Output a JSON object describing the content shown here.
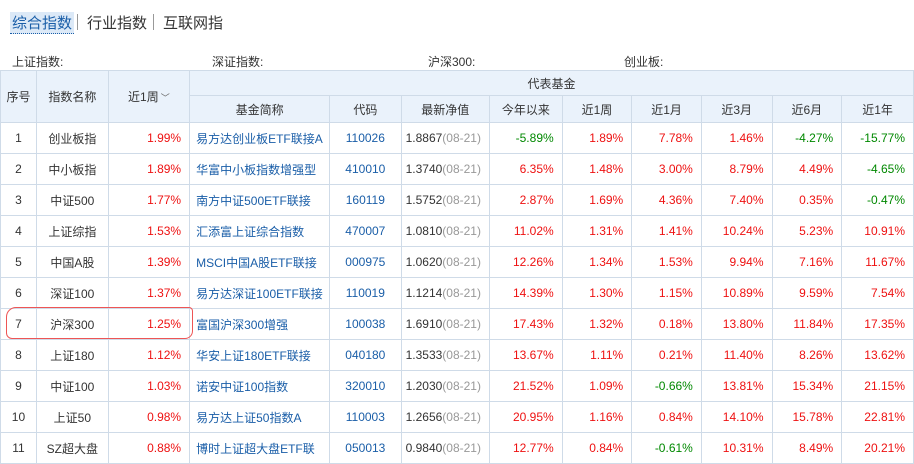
{
  "tabs": [
    {
      "label": "综合指数",
      "active": true
    },
    {
      "label": "行业指数",
      "active": false
    },
    {
      "label": "互联网指",
      "active": false
    }
  ],
  "quotes": [
    {
      "label": "上证指数:"
    },
    {
      "label": "深证指数:"
    },
    {
      "label": "沪深300:"
    },
    {
      "label": "创业板:"
    }
  ],
  "headers": {
    "index": "序号",
    "name": "指数名称",
    "week": "近1周",
    "group": "代表基金",
    "fund": "基金简称",
    "code": "代码",
    "nav": "最新净值",
    "ytd": "今年以来",
    "f1w": "近1周",
    "f1m": "近1月",
    "f3m": "近3月",
    "f6m": "近6月",
    "f1y": "近1年"
  },
  "rows": [
    {
      "no": "1",
      "name": "创业板指",
      "week": "1.99%",
      "fund": "易方达创业板ETF联接A",
      "code": "110026",
      "nav": "1.8867",
      "date": "(08-21)",
      "ytd": "-5.89%",
      "w1": "1.89%",
      "m1": "7.78%",
      "m3": "1.46%",
      "m6": "-4.27%",
      "y1": "-15.77%"
    },
    {
      "no": "2",
      "name": "中小板指",
      "week": "1.89%",
      "fund": "华富中小板指数增强型",
      "code": "410010",
      "nav": "1.3740",
      "date": "(08-21)",
      "ytd": "6.35%",
      "w1": "1.48%",
      "m1": "3.00%",
      "m3": "8.79%",
      "m6": "4.49%",
      "y1": "-4.65%"
    },
    {
      "no": "3",
      "name": "中证500",
      "week": "1.77%",
      "fund": "南方中证500ETF联接",
      "code": "160119",
      "nav": "1.5752",
      "date": "(08-21)",
      "ytd": "2.87%",
      "w1": "1.69%",
      "m1": "4.36%",
      "m3": "7.40%",
      "m6": "0.35%",
      "y1": "-0.47%"
    },
    {
      "no": "4",
      "name": "上证综指",
      "week": "1.53%",
      "fund": "汇添富上证综合指数",
      "code": "470007",
      "nav": "1.0810",
      "date": "(08-21)",
      "ytd": "11.02%",
      "w1": "1.31%",
      "m1": "1.41%",
      "m3": "10.24%",
      "m6": "5.23%",
      "y1": "10.91%"
    },
    {
      "no": "5",
      "name": "中国A股",
      "week": "1.39%",
      "fund": "MSCI中国A股ETF联接",
      "code": "000975",
      "nav": "1.0620",
      "date": "(08-21)",
      "ytd": "12.26%",
      "w1": "1.34%",
      "m1": "1.53%",
      "m3": "9.94%",
      "m6": "7.16%",
      "y1": "11.67%"
    },
    {
      "no": "6",
      "name": "深证100",
      "week": "1.37%",
      "fund": "易方达深证100ETF联接",
      "code": "110019",
      "nav": "1.1214",
      "date": "(08-21)",
      "ytd": "14.39%",
      "w1": "1.30%",
      "m1": "1.15%",
      "m3": "10.89%",
      "m6": "9.59%",
      "y1": "7.54%"
    },
    {
      "no": "7",
      "name": "沪深300",
      "week": "1.25%",
      "fund": "富国沪深300增强",
      "code": "100038",
      "nav": "1.6910",
      "date": "(08-21)",
      "ytd": "17.43%",
      "w1": "1.32%",
      "m1": "0.18%",
      "m3": "13.80%",
      "m6": "11.84%",
      "y1": "17.35%"
    },
    {
      "no": "8",
      "name": "上证180",
      "week": "1.12%",
      "fund": "华安上证180ETF联接",
      "code": "040180",
      "nav": "1.3533",
      "date": "(08-21)",
      "ytd": "13.67%",
      "w1": "1.11%",
      "m1": "0.21%",
      "m3": "11.40%",
      "m6": "8.26%",
      "y1": "13.62%"
    },
    {
      "no": "9",
      "name": "中证100",
      "week": "1.03%",
      "fund": "诺安中证100指数",
      "code": "320010",
      "nav": "1.2030",
      "date": "(08-21)",
      "ytd": "21.52%",
      "w1": "1.09%",
      "m1": "-0.66%",
      "m3": "13.81%",
      "m6": "15.34%",
      "y1": "21.15%"
    },
    {
      "no": "10",
      "name": "上证50",
      "week": "0.98%",
      "fund": "易方达上证50指数A",
      "code": "110003",
      "nav": "1.2656",
      "date": "(08-21)",
      "ytd": "20.95%",
      "w1": "1.16%",
      "m1": "0.84%",
      "m3": "14.10%",
      "m6": "15.78%",
      "y1": "22.81%"
    },
    {
      "no": "11",
      "name": "SZ超大盘",
      "week": "0.88%",
      "fund": "博时上证超大盘ETF联",
      "code": "050013",
      "nav": "0.9840",
      "date": "(08-21)",
      "ytd": "12.77%",
      "w1": "0.84%",
      "m1": "-0.61%",
      "m3": "10.31%",
      "m6": "8.49%",
      "y1": "20.21%"
    }
  ],
  "icons": {
    "sort": "chevron-down-icon"
  },
  "colors": {
    "up": "#e11111",
    "down": "#008800",
    "link": "#1a5ea8",
    "header_bg": "#eaf2fb"
  }
}
